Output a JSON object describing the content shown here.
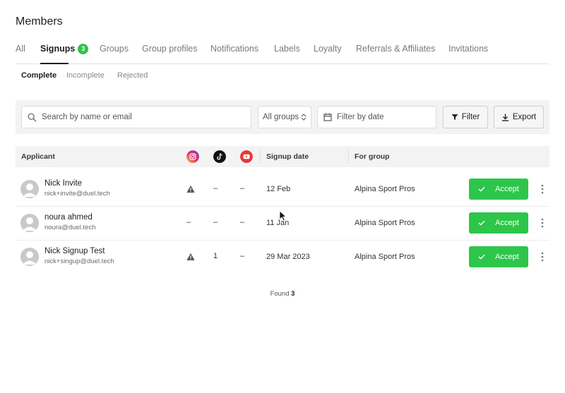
{
  "page": {
    "title": "Members"
  },
  "tabs": [
    {
      "label": "All"
    },
    {
      "label": "Signups",
      "badge": "3"
    },
    {
      "label": "Groups"
    },
    {
      "label": "Group profiles"
    },
    {
      "label": "Notifications"
    },
    {
      "label": "Labels"
    },
    {
      "label": "Loyalty"
    },
    {
      "label": "Referrals & Affiliates"
    },
    {
      "label": "Invitations"
    }
  ],
  "subtabs": [
    {
      "label": "Complete"
    },
    {
      "label": "Incomplete"
    },
    {
      "label": "Rejected"
    }
  ],
  "filters": {
    "search_placeholder": "Search by name or email",
    "groups_select": "All groups",
    "date_placeholder": "Filter by date",
    "filter_button": "Filter",
    "export_button": "Export"
  },
  "table": {
    "headers": {
      "applicant": "Applicant",
      "signup_date": "Signup date",
      "for_group": "For group"
    },
    "social_icons": [
      "instagram-icon",
      "tiktok-icon",
      "youtube-icon"
    ],
    "accept_label": "Accept",
    "rows": [
      {
        "name": "Nick Invite",
        "email": "nick+invite@duel.tech",
        "instagram": "warning",
        "tiktok": "–",
        "youtube": "–",
        "date": "12 Feb",
        "group": "Alpina Sport Pros"
      },
      {
        "name": "noura ahmed",
        "email": "noura@duel.tech",
        "instagram": "–",
        "tiktok": "–",
        "youtube": "–",
        "date": "11 Jan",
        "group": "Alpina Sport Pros"
      },
      {
        "name": "Nick Signup Test",
        "email": "nick+singup@duel.tech",
        "instagram": "warning",
        "tiktok": "1",
        "youtube": "–",
        "date": "29 Mar 2023",
        "group": "Alpina Sport Pros"
      }
    ]
  },
  "footer": {
    "found_label": "Found",
    "found_count": "3"
  },
  "colors": {
    "accent": "#2dc64a",
    "badge": "#2fc14d",
    "youtube": "#e23a3a",
    "tiktok": "#111111"
  }
}
